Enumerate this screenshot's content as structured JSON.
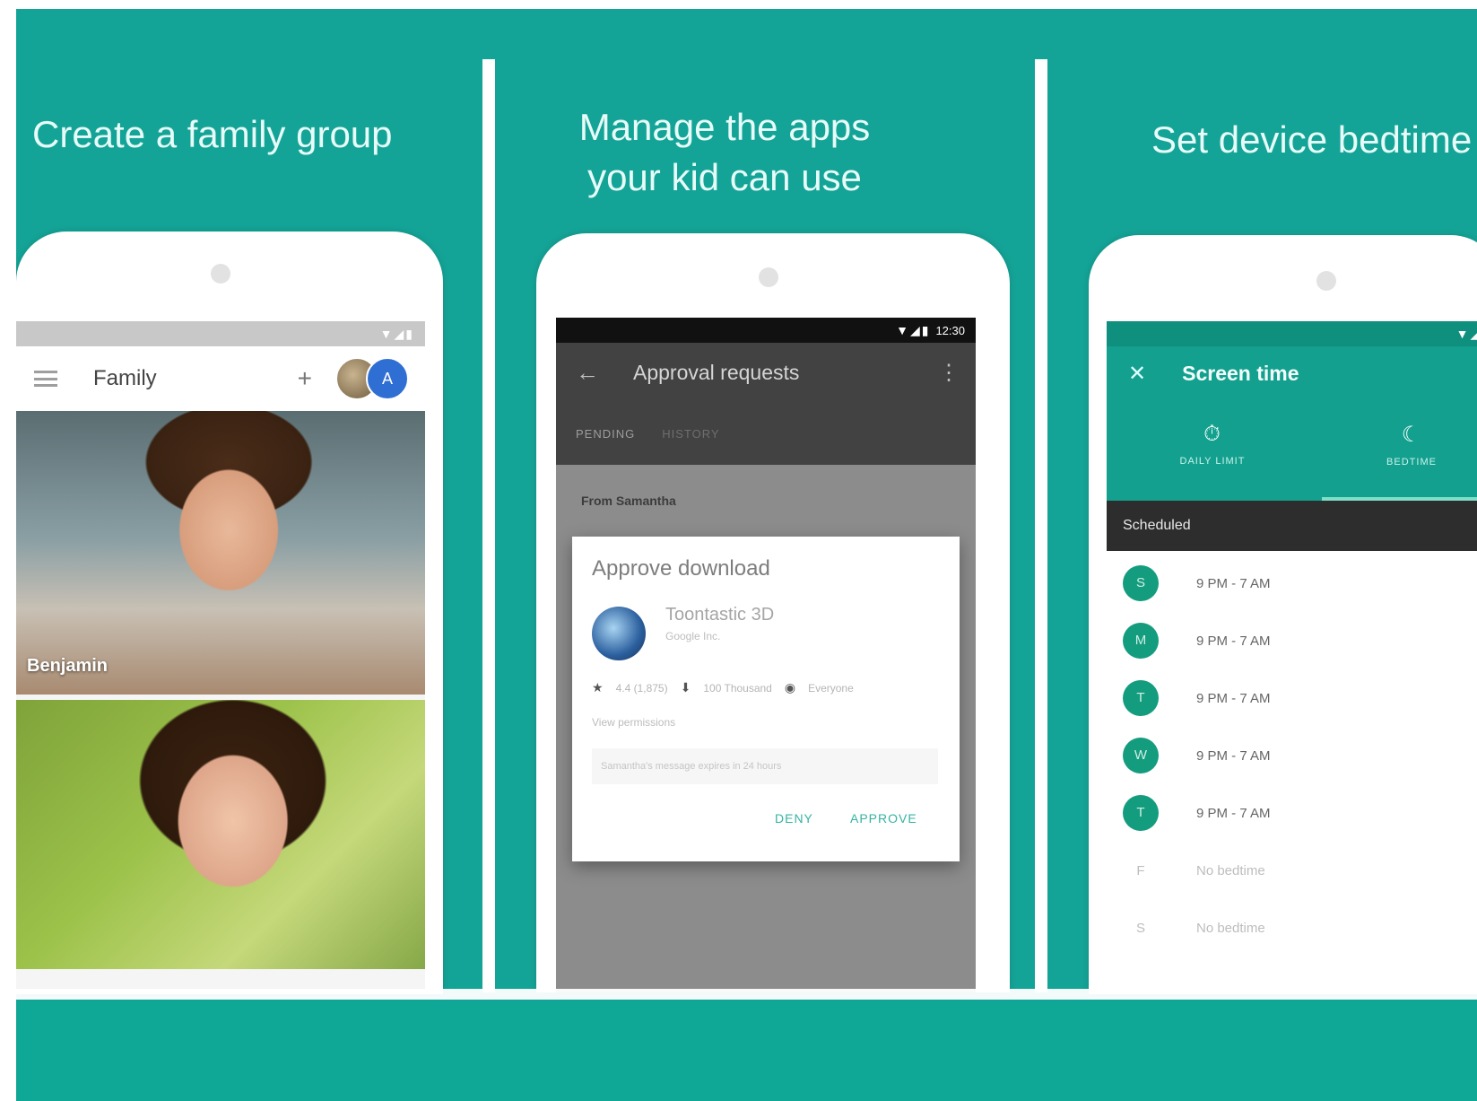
{
  "panels": [
    {
      "title": "Create a family group"
    },
    {
      "title_line1": "Manage the apps",
      "title_line2": "your kid can use"
    },
    {
      "title": "Set device bedtime"
    }
  ],
  "phone1": {
    "app_bar_title": "Family",
    "avatar_initial": "A",
    "photo_caption": "Benjamin"
  },
  "phone2": {
    "status_time": "12:30",
    "app_bar_title": "Approval requests",
    "tabs": [
      "PENDING",
      "HISTORY"
    ],
    "from_label": "From Samantha",
    "dialog": {
      "title": "Approve download",
      "app_name": "Toontastic 3D",
      "developer": "Google Inc.",
      "rating": "4.4 (1,875)",
      "downloads": "100 Thousand",
      "audience": "Everyone",
      "permissions_link": "View permissions",
      "note": "Samantha's message expires in 24 hours",
      "deny": "DENY",
      "approve": "APPROVE"
    }
  },
  "phone3": {
    "app_bar_title": "Screen time",
    "tabs": [
      "DAILY LIMIT",
      "BEDTIME"
    ],
    "scheduled_label": "Scheduled",
    "days": [
      {
        "letter": "S",
        "time": "9 PM - 7 AM",
        "active": true
      },
      {
        "letter": "M",
        "time": "9 PM - 7 AM",
        "active": true
      },
      {
        "letter": "T",
        "time": "9 PM - 7 AM",
        "active": true
      },
      {
        "letter": "W",
        "time": "9 PM - 7 AM",
        "active": true
      },
      {
        "letter": "T",
        "time": "9 PM - 7 AM",
        "active": true
      },
      {
        "letter": "F",
        "time": "No bedtime",
        "active": false
      },
      {
        "letter": "S",
        "time": "No bedtime",
        "active": false
      }
    ]
  },
  "colors": {
    "background": "#14a497",
    "accent": "#36b3a4",
    "day_badge": "#149c7e"
  },
  "icons": [
    "menu-icon",
    "plus-icon",
    "back-icon",
    "kebab-icon",
    "close-icon",
    "timer-icon",
    "moon-icon",
    "star-icon",
    "download-icon",
    "audience-icon"
  ]
}
